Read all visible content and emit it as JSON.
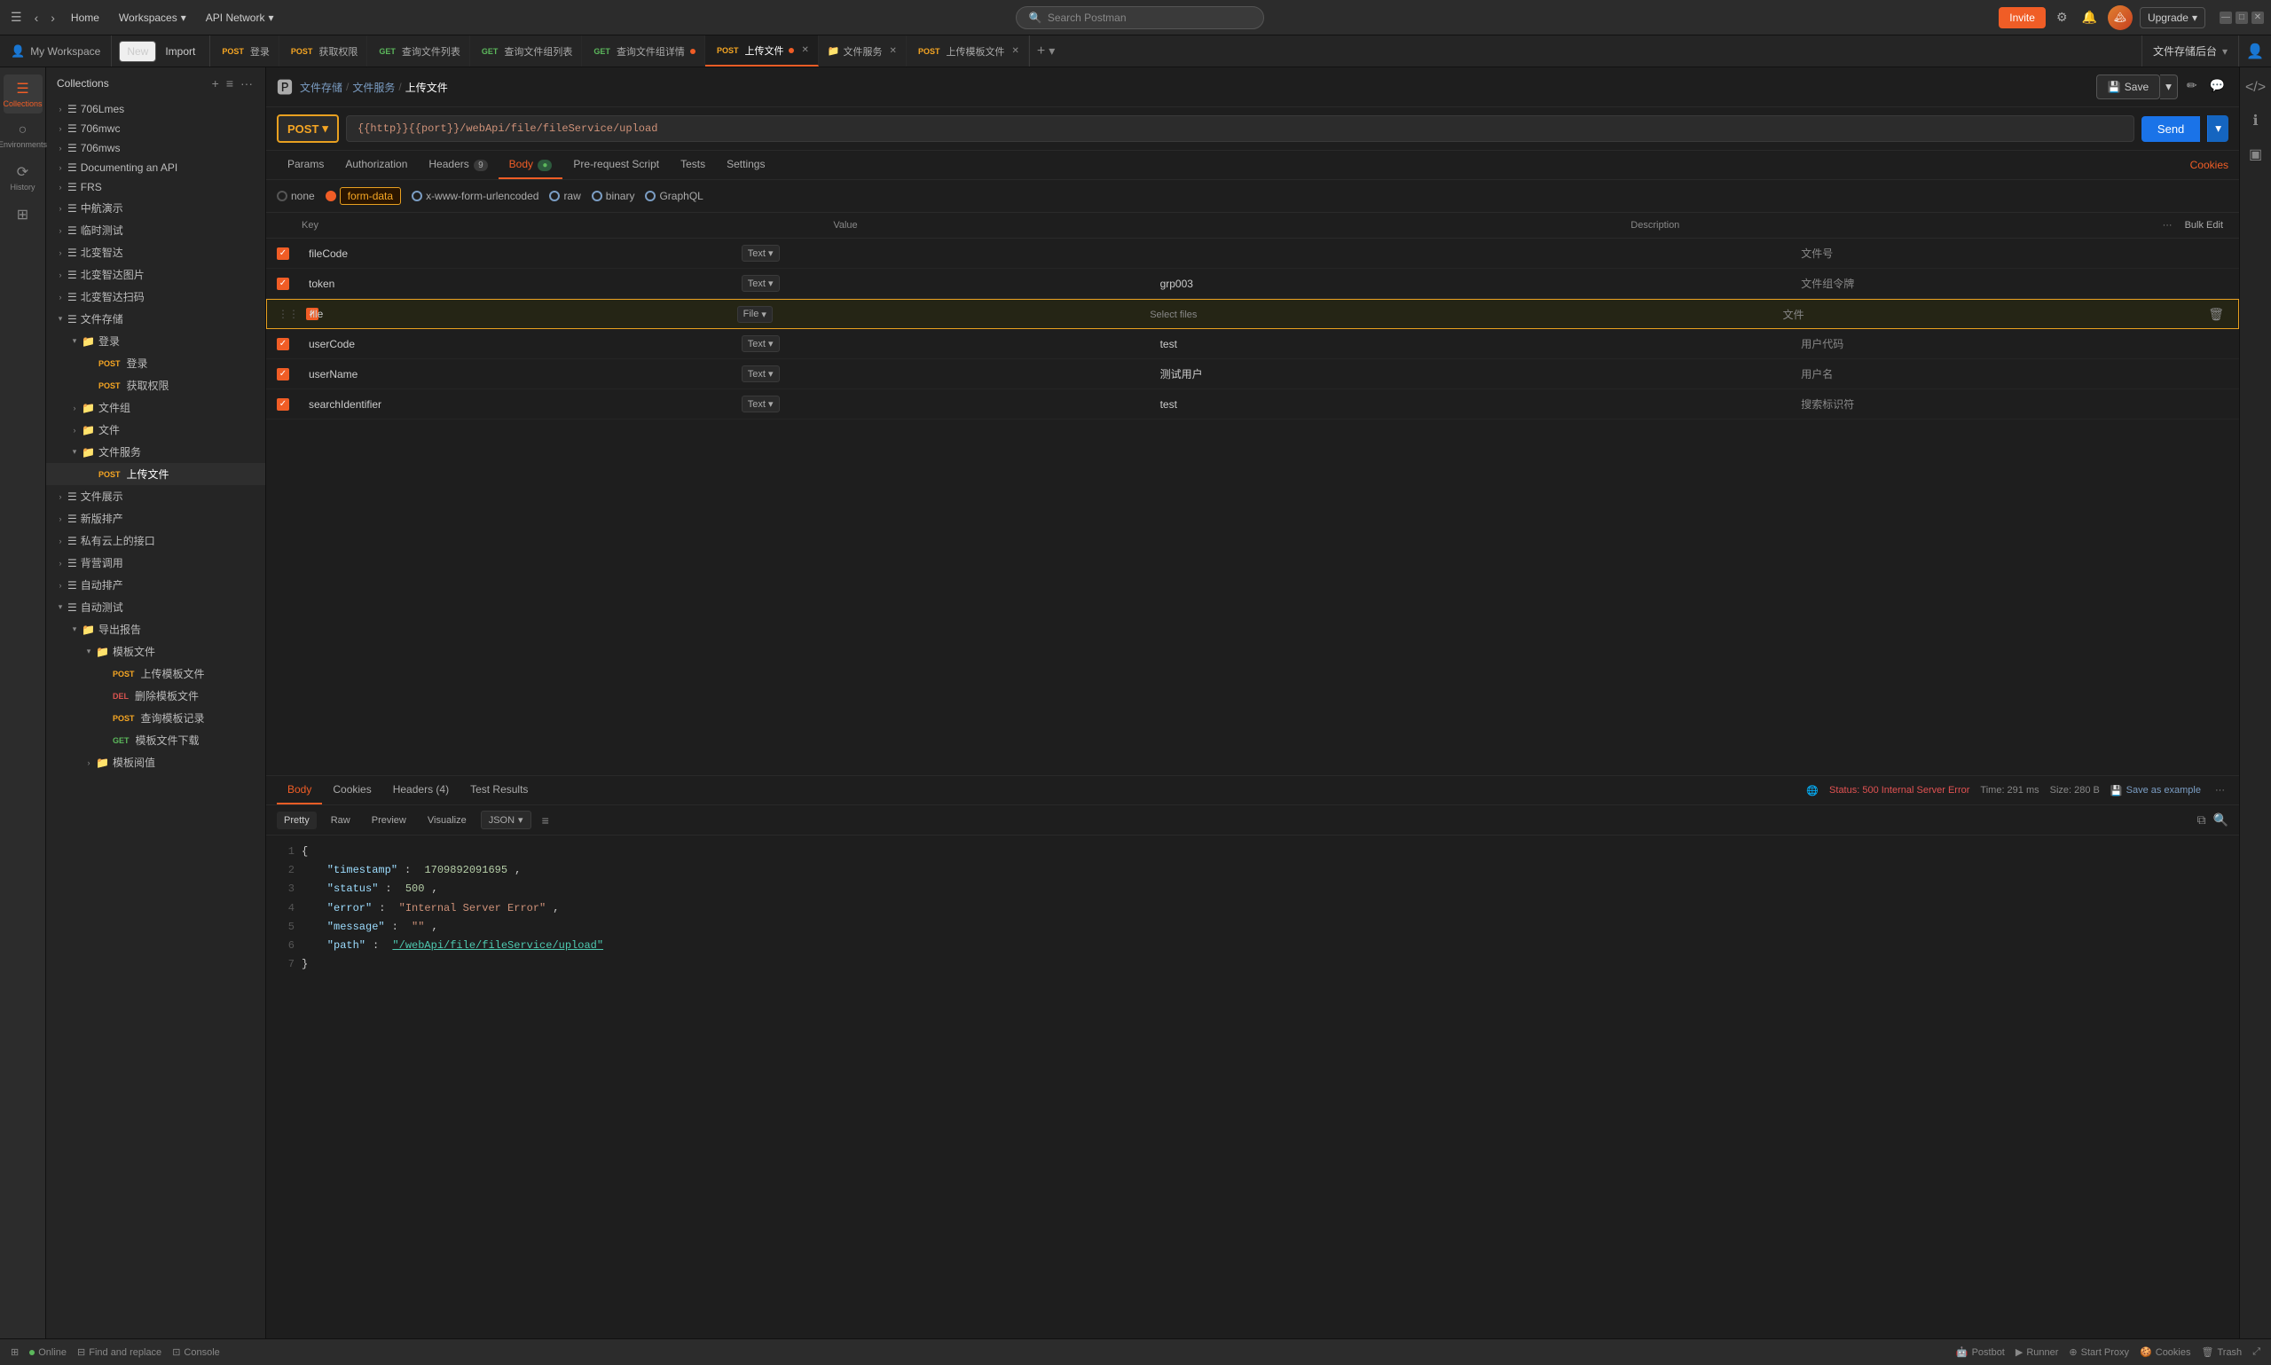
{
  "topbar": {
    "home_label": "Home",
    "workspaces_label": "Workspaces",
    "api_network_label": "API Network",
    "search_placeholder": "Search Postman",
    "invite_label": "Invite",
    "upgrade_label": "Upgrade"
  },
  "workspace": {
    "label": "My Workspace"
  },
  "toolbar": {
    "new_label": "New",
    "import_label": "Import"
  },
  "tabs": [
    {
      "method": "POST",
      "label": "登录",
      "type": "post"
    },
    {
      "method": "POST",
      "label": "获取权限",
      "type": "post"
    },
    {
      "method": "GET",
      "label": "查询文件列表",
      "type": "get"
    },
    {
      "method": "GET",
      "label": "查询文件组列表",
      "type": "get"
    },
    {
      "method": "GET",
      "label": "查询文件组详情",
      "type": "get",
      "dot": true
    },
    {
      "method": "POST",
      "label": "上传文件",
      "type": "post",
      "active": true,
      "dot": true
    },
    {
      "method": "",
      "label": "文件服务",
      "type": "folder"
    },
    {
      "method": "POST",
      "label": "上传模板文件",
      "type": "post"
    }
  ],
  "file_storage_label": "文件存储后台",
  "breadcrumb": {
    "root": "文件存储",
    "parent": "文件服务",
    "current": "上传文件"
  },
  "request": {
    "method": "POST",
    "url": "{{http}}{{port}}/webApi/file/fileService/upload",
    "send_label": "Send"
  },
  "req_tabs": [
    {
      "label": "Params"
    },
    {
      "label": "Authorization"
    },
    {
      "label": "Headers",
      "badge": "9"
    },
    {
      "label": "Body",
      "active": true,
      "dot": true
    },
    {
      "label": "Pre-request Script"
    },
    {
      "label": "Tests"
    },
    {
      "label": "Settings"
    }
  ],
  "cookies_label": "Cookies",
  "body_options": [
    {
      "label": "none",
      "checked": false
    },
    {
      "label": "form-data",
      "checked": true
    },
    {
      "label": "x-www-form-urlencoded",
      "checked": false
    },
    {
      "label": "raw",
      "checked": false
    },
    {
      "label": "binary",
      "checked": false
    },
    {
      "label": "GraphQL",
      "checked": false
    }
  ],
  "table_headers": {
    "key": "Key",
    "value": "Value",
    "description": "Description",
    "bulk_edit": "Bulk Edit"
  },
  "form_rows": [
    {
      "checked": true,
      "key": "fileCode",
      "type": "Text",
      "value": "",
      "description": "文件号",
      "highlighted": false,
      "file": false
    },
    {
      "checked": true,
      "key": "token",
      "type": "Text",
      "value": "grp003",
      "description": "文件组令牌",
      "highlighted": false,
      "file": false
    },
    {
      "checked": true,
      "key": "file",
      "type": "File",
      "value": "Select files",
      "description": "文件",
      "highlighted": true,
      "file": true
    },
    {
      "checked": true,
      "key": "userCode",
      "type": "Text",
      "value": "test",
      "description": "用户代码",
      "highlighted": false,
      "file": false
    },
    {
      "checked": true,
      "key": "userName",
      "type": "Text",
      "value": "测试用户",
      "description": "用户名",
      "highlighted": false,
      "file": false
    },
    {
      "checked": true,
      "key": "searchIdentifier",
      "type": "Text",
      "value": "test",
      "description": "搜索标识符",
      "highlighted": false,
      "file": false
    }
  ],
  "response": {
    "tabs": [
      "Body",
      "Cookies",
      "Headers (4)",
      "Test Results"
    ],
    "active_tab": "Body",
    "status": "Status: 500 Internal Server Error",
    "time": "Time: 291 ms",
    "size": "Size: 280 B",
    "save_example": "Save as example",
    "format_tabs": [
      "Pretty",
      "Raw",
      "Preview",
      "Visualize"
    ],
    "active_format": "Pretty",
    "format": "JSON",
    "json_lines": [
      {
        "num": 1,
        "content": "{",
        "type": "punct"
      },
      {
        "num": 2,
        "content": "    \"timestamp\": 1709892091695,",
        "type": "key_num"
      },
      {
        "num": 3,
        "content": "    \"status\": 500,",
        "type": "key_num"
      },
      {
        "num": 4,
        "content": "    \"error\": \"Internal Server Error\",",
        "type": "key_str"
      },
      {
        "num": 5,
        "content": "    \"message\": \"\",",
        "type": "key_str"
      },
      {
        "num": 6,
        "content": "    \"path\": \"/webApi/file/fileService/upload\"",
        "type": "key_url"
      },
      {
        "num": 7,
        "content": "}",
        "type": "punct"
      }
    ]
  },
  "sidebar_nav": [
    {
      "icon": "☰",
      "label": "Collections",
      "active": true
    },
    {
      "icon": "○",
      "label": "Environments"
    },
    {
      "icon": "⊞",
      "label": "History"
    }
  ],
  "collections": [
    {
      "label": "706Lmes",
      "depth": 0,
      "expanded": false
    },
    {
      "label": "706mwc",
      "depth": 0,
      "expanded": false
    },
    {
      "label": "706mws",
      "depth": 0,
      "expanded": false
    },
    {
      "label": "Documenting an API",
      "depth": 0,
      "expanded": false
    },
    {
      "label": "FRS",
      "depth": 0,
      "expanded": false
    },
    {
      "label": "中航演示",
      "depth": 0,
      "expanded": false
    },
    {
      "label": "临时测试",
      "depth": 0,
      "expanded": false
    },
    {
      "label": "北变智达",
      "depth": 0,
      "expanded": false
    },
    {
      "label": "北变智达图片",
      "depth": 0,
      "expanded": false
    },
    {
      "label": "北变智达扫码",
      "depth": 0,
      "expanded": false
    },
    {
      "label": "文件存储",
      "depth": 0,
      "expanded": true,
      "children": [
        {
          "label": "登录",
          "depth": 1,
          "expanded": true,
          "icon": "folder",
          "children": [
            {
              "method": "POST",
              "label": "登录",
              "depth": 2
            },
            {
              "method": "POST",
              "label": "获取权限",
              "depth": 2
            }
          ]
        },
        {
          "label": "文件组",
          "depth": 1,
          "expanded": false,
          "icon": "folder"
        },
        {
          "label": "文件",
          "depth": 1,
          "expanded": false,
          "icon": "folder"
        },
        {
          "label": "文件服务",
          "depth": 1,
          "expanded": true,
          "icon": "folder",
          "children": [
            {
              "method": "POST",
              "label": "上传文件",
              "depth": 2,
              "active": true
            }
          ]
        }
      ]
    },
    {
      "label": "文件展示",
      "depth": 0,
      "expanded": false
    },
    {
      "label": "新版排产",
      "depth": 0,
      "expanded": false
    },
    {
      "label": "私有云上的接口",
      "depth": 0,
      "expanded": false
    },
    {
      "label": "背营调用",
      "depth": 0,
      "expanded": false
    },
    {
      "label": "自动排产",
      "depth": 0,
      "expanded": false
    },
    {
      "label": "自动测试",
      "depth": 0,
      "expanded": true,
      "children": [
        {
          "label": "导出报告",
          "depth": 1,
          "expanded": true,
          "icon": "folder",
          "children": [
            {
              "label": "模板文件",
              "depth": 2,
              "expanded": true,
              "icon": "folder",
              "children": [
                {
                  "method": "POST",
                  "label": "上传模板文件",
                  "depth": 3
                },
                {
                  "method": "DEL",
                  "label": "删除模板文件",
                  "depth": 3
                },
                {
                  "method": "POST",
                  "label": "查询模板记录",
                  "depth": 3
                },
                {
                  "method": "GET",
                  "label": "模板文件下载",
                  "depth": 3
                }
              ]
            },
            {
              "label": "模板阅值",
              "depth": 2,
              "expanded": false,
              "icon": "folder"
            }
          ]
        }
      ]
    }
  ],
  "bottombar": {
    "online_label": "Online",
    "find_replace_label": "Find and replace",
    "console_label": "Console",
    "postbot_label": "Postbot",
    "runner_label": "Runner",
    "start_proxy_label": "Start Proxy",
    "cookies_label": "Cookies",
    "trash_label": "Trash"
  }
}
